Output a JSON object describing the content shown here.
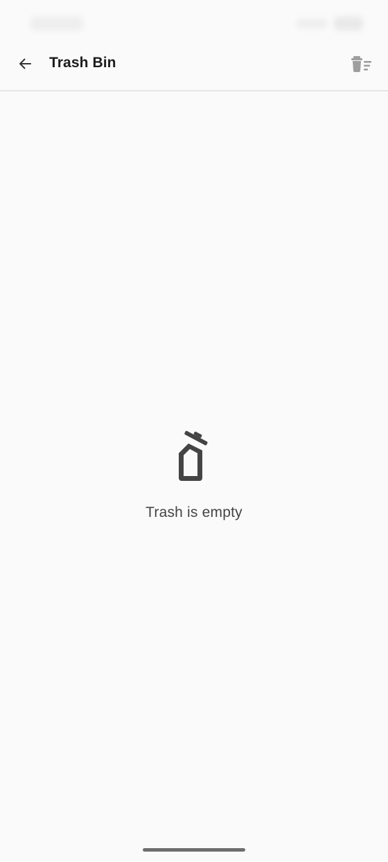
{
  "app_bar": {
    "title": "Trash Bin",
    "back_icon": "arrow-left-icon",
    "action_icon": "delete-sweep-icon"
  },
  "empty_state": {
    "icon": "trash-open-icon",
    "message": "Trash is empty"
  },
  "colors": {
    "background": "#fafafa",
    "title_text": "#1c1c1c",
    "icon_dark": "#444444",
    "icon_muted": "#9e9e9e",
    "divider": "#e6e6e6"
  }
}
